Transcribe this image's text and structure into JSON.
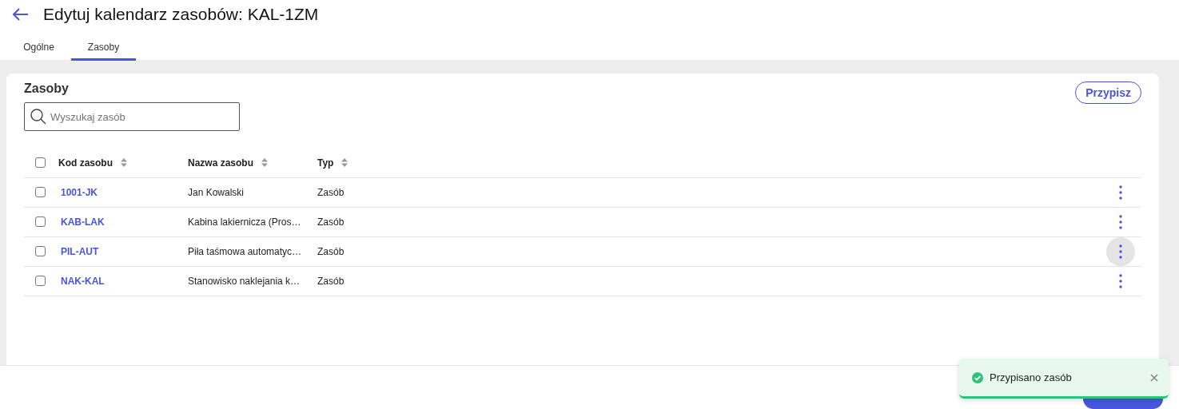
{
  "header": {
    "title": "Edytuj kalendarz zasobów: KAL-1ZM"
  },
  "tabs": [
    {
      "label": "Ogólne",
      "selected": false
    },
    {
      "label": "Zasoby",
      "selected": true
    }
  ],
  "panel": {
    "title": "Zasoby",
    "assign_button": "Przypisz",
    "search": {
      "placeholder": "Wyszukaj zasób"
    },
    "table": {
      "all_checked": false,
      "columns": [
        "Kod zasobu",
        "Nazwa zasobu",
        "Typ"
      ],
      "rows": [
        {
          "checked": false,
          "code": "1001-JK",
          "name": "Jan Kowalski",
          "type": "Zasób",
          "menu_highlighted": false
        },
        {
          "checked": false,
          "code": "KAB-LAK",
          "name": "Kabina lakiernicza (Pros…",
          "type": "Zasób",
          "menu_highlighted": false
        },
        {
          "checked": false,
          "code": "PIL-AUT",
          "name": "Piła taśmowa automatyc…",
          "type": "Zasób",
          "menu_highlighted": true
        },
        {
          "checked": false,
          "code": "NAK-KAL",
          "name": "Stanowisko naklejania k…",
          "type": "Zasób",
          "menu_highlighted": false
        }
      ]
    }
  },
  "toast": {
    "kind": "success",
    "message": "Przypisano zasób"
  }
}
